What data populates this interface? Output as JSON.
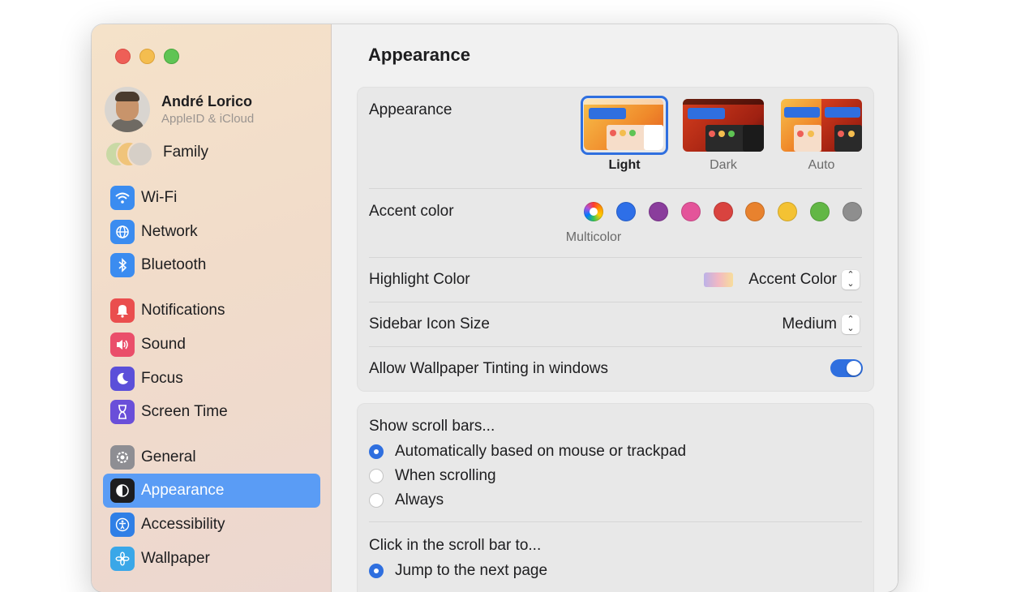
{
  "profile": {
    "name": "André Lorico",
    "subtitle": "AppleID & iCloud"
  },
  "family": {
    "label": "Family"
  },
  "sidebar": {
    "items": [
      {
        "label": "Wi-Fi",
        "icon": "wifi-icon",
        "color": "#3b8cf0"
      },
      {
        "label": "Network",
        "icon": "globe-icon",
        "color": "#3b8cf0"
      },
      {
        "label": "Bluetooth",
        "icon": "bluetooth-icon",
        "color": "#3b8cf0"
      },
      {
        "label": "Notifications",
        "icon": "bell-icon",
        "color": "#ea4e4e"
      },
      {
        "label": "Sound",
        "icon": "speaker-icon",
        "color": "#ea4e6a"
      },
      {
        "label": "Focus",
        "icon": "moon-icon",
        "color": "#5b4fd9"
      },
      {
        "label": "Screen Time",
        "icon": "hourglass-icon",
        "color": "#6a4fd9"
      },
      {
        "label": "General",
        "icon": "gear-icon",
        "color": "#8e8e93"
      },
      {
        "label": "Appearance",
        "icon": "appearance-icon",
        "color": "#1d1d1f",
        "selected": true
      },
      {
        "label": "Accessibility",
        "icon": "accessibility-icon",
        "color": "#2f7fe6"
      },
      {
        "label": "Wallpaper",
        "icon": "flower-icon",
        "color": "#3aa7e8"
      }
    ]
  },
  "main": {
    "title": "Appearance",
    "appearance": {
      "label": "Appearance",
      "options": [
        {
          "label": "Light",
          "selected": true
        },
        {
          "label": "Dark",
          "selected": false
        },
        {
          "label": "Auto",
          "selected": false
        }
      ]
    },
    "accent": {
      "label": "Accent color",
      "selected_name": "Multicolor",
      "colors": [
        "multicolor",
        "#2e6fe8",
        "#8a3d9c",
        "#e4549a",
        "#d9433f",
        "#e8822e",
        "#f4c233",
        "#62b745",
        "#8e8e8e"
      ]
    },
    "highlight": {
      "label": "Highlight Color",
      "value": "Accent Color"
    },
    "sidebar_icon_size": {
      "label": "Sidebar Icon Size",
      "value": "Medium"
    },
    "wallpaper_tinting": {
      "label": "Allow Wallpaper Tinting in windows",
      "enabled": true
    },
    "scroll_bars": {
      "label": "Show scroll bars...",
      "options": [
        {
          "label": "Automatically based on mouse or trackpad",
          "selected": true
        },
        {
          "label": "When scrolling",
          "selected": false
        },
        {
          "label": "Always",
          "selected": false
        }
      ]
    },
    "click_scroll": {
      "label": "Click in the scroll bar to...",
      "options": [
        {
          "label": "Jump to the next page",
          "selected": true
        }
      ]
    }
  }
}
